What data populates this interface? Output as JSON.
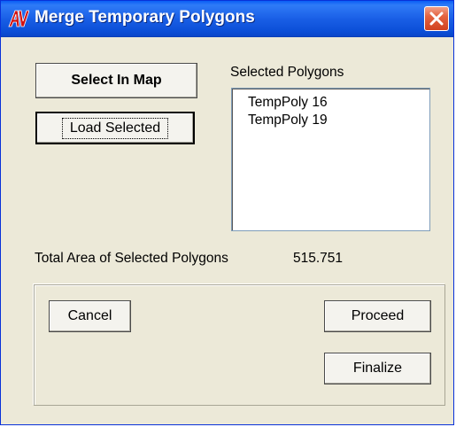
{
  "window": {
    "title": "Merge Temporary Polygons",
    "icon": "av-app-icon",
    "close_icon": "close-icon",
    "accent": "#0a5ef5"
  },
  "buttons": {
    "select_in_map": "Select In Map",
    "load_selected": "Load Selected",
    "cancel": "Cancel",
    "proceed": "Proceed",
    "finalize": "Finalize"
  },
  "selected_polygons": {
    "label": "Selected Polygons",
    "items": [
      "TempPoly 16",
      "TempPoly 19"
    ]
  },
  "total_area": {
    "label": "Total Area of Selected Polygons",
    "value": "515.751"
  }
}
